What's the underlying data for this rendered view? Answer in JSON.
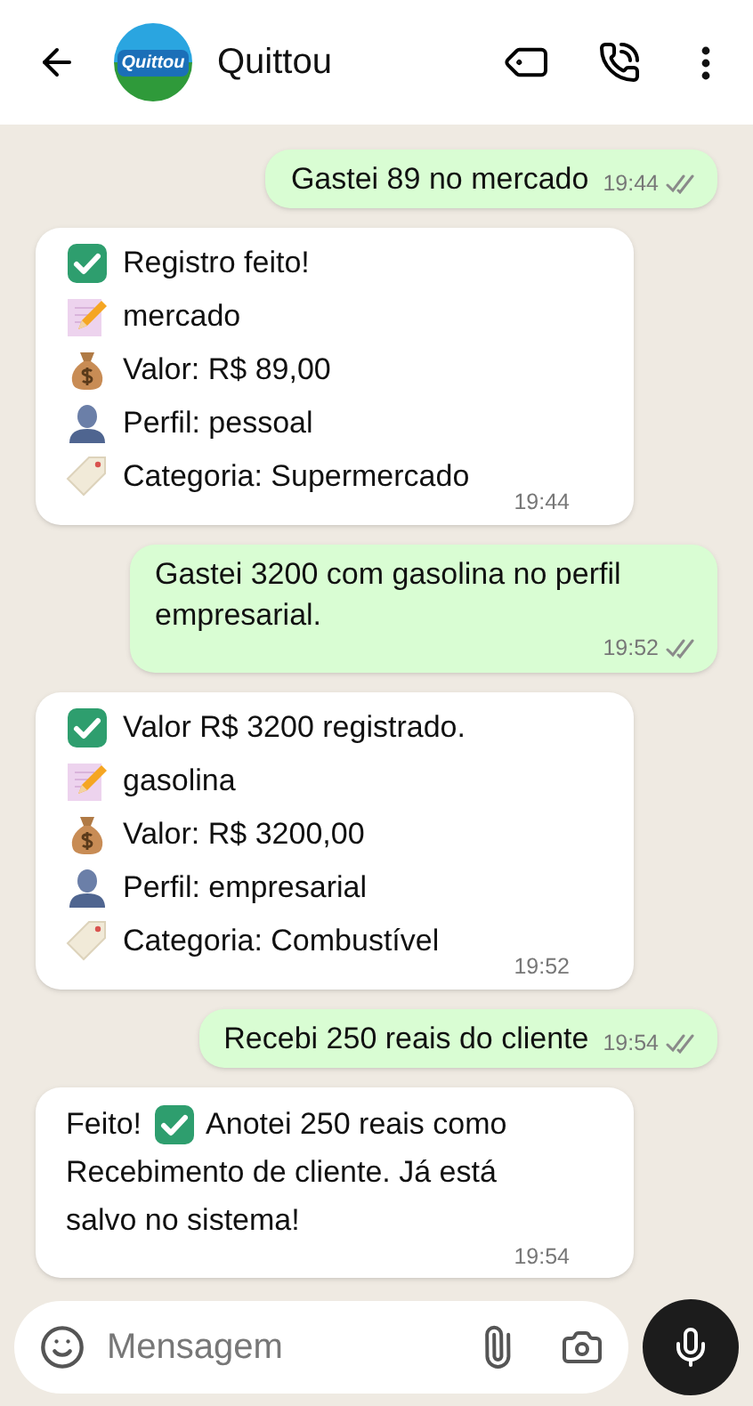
{
  "header": {
    "title": "Quittou",
    "avatar_text": "Quittou"
  },
  "messages": [
    {
      "outgoing": true,
      "text": "Gastei 89 no mercado",
      "time": "19:44",
      "read": false
    },
    {
      "outgoing": false,
      "lines": [
        {
          "kind": "check",
          "text": "Registro feito!"
        },
        {
          "kind": "memo",
          "text": "mercado"
        },
        {
          "kind": "money",
          "text": "Valor: R$ 89,00"
        },
        {
          "kind": "person",
          "text": "Perfil: pessoal"
        },
        {
          "kind": "tag",
          "text": "Categoria: Supermercado"
        }
      ],
      "time": "19:44"
    },
    {
      "outgoing": true,
      "text": "Gastei 3200 com gasolina no perfil empresarial.",
      "time": "19:52",
      "read": false
    },
    {
      "outgoing": false,
      "lines": [
        {
          "kind": "check",
          "text": "Valor R$ 3200 registrado."
        },
        {
          "kind": "memo",
          "text": "gasolina"
        },
        {
          "kind": "money",
          "text": "Valor: R$ 3200,00"
        },
        {
          "kind": "person",
          "text": "Perfil: empresarial"
        },
        {
          "kind": "tag",
          "text": "Categoria: Combustível"
        }
      ],
      "time": "19:52"
    },
    {
      "outgoing": true,
      "text": "Recebi 250 reais do cliente",
      "time": "19:54",
      "read": false
    },
    {
      "outgoing": false,
      "paragraph": [
        [
          {
            "kind": "text",
            "text": "Feito!"
          },
          {
            "kind": "check"
          },
          {
            "kind": "text",
            "text": "Anotei 250 reais como"
          }
        ],
        [
          {
            "kind": "text",
            "text": "Recebimento de cliente. Já está salvo no sistema!"
          }
        ]
      ],
      "time": "19:54"
    }
  ],
  "composer": {
    "placeholder": "Mensagem"
  }
}
